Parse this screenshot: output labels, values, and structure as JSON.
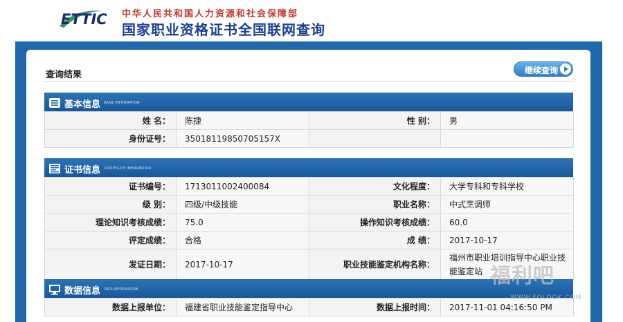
{
  "header": {
    "logo_text": "ETTIC",
    "ministry": "中华人民共和国人力资源和社会保障部",
    "title": "国家职业资格证书全国联网查询"
  },
  "page": {
    "result_title": "查询结果",
    "continue_button": "继续查询"
  },
  "sections": {
    "basic": {
      "title": "基本信息",
      "subtitle": "BASIC INFORMATION",
      "icon": "list-icon",
      "rows": [
        {
          "k1": "姓 名：",
          "v1": "陈捷",
          "k2": "性 别：",
          "v2": "男"
        },
        {
          "k1": "身份证号：",
          "v1": "35018119850705157X",
          "k2": "",
          "v2": ""
        }
      ]
    },
    "certificate": {
      "title": "证书信息",
      "subtitle": "CERTIFICATE INFORMATION",
      "icon": "certificate-icon",
      "rows": [
        {
          "k1": "证书编号：",
          "v1": "1713011002400084",
          "k2": "文化程度：",
          "v2": "大学专科和专科学校"
        },
        {
          "k1": "级 别：",
          "v1": "四级/中级技能",
          "k2": "职业名称：",
          "v2": "中式烹调师"
        },
        {
          "k1": "理论知识考核成绩：",
          "v1": "75.0",
          "k2": "操作知识考核成绩：",
          "v2": "60.0"
        },
        {
          "k1": "评定成绩：",
          "v1": "合格",
          "k2": "成 绩：",
          "v2": "2017-10-17"
        },
        {
          "k1": "发证日期：",
          "v1": "2017-10-17",
          "k2": "职业技能鉴定机构名称：",
          "v2": "福州市职业培训指导中心职业技能鉴定站"
        }
      ]
    },
    "data": {
      "title": "数据信息",
      "subtitle": "DATA INFORMATION",
      "icon": "monitor-icon",
      "rows": [
        {
          "k1": "数据上报单位：",
          "v1": "福建省职业技能鉴定指导中心",
          "k2": "数据上报时间：",
          "v2": "2017-11-01 04:16:50 PM"
        }
      ]
    }
  },
  "watermark": {
    "text": "福利吧",
    "url": "WWW.FQLOOK.COM"
  },
  "colors": {
    "frame_blue": "#1f67ad",
    "title_blue": "#1b3f94",
    "ministry_red": "#c0392b"
  }
}
